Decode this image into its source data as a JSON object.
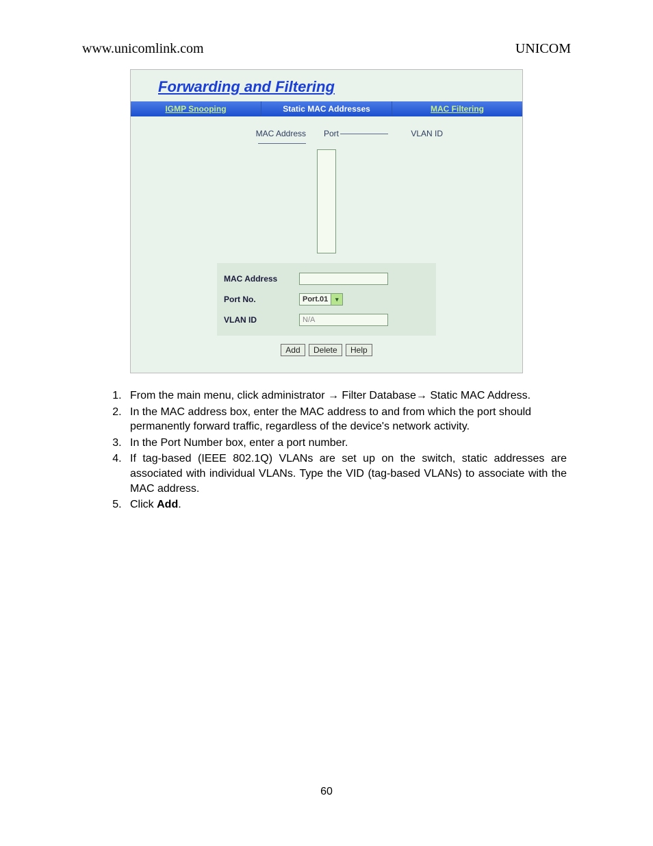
{
  "header": {
    "left": "www.unicomlink.com",
    "right": "UNICOM"
  },
  "screenshot": {
    "title": "Forwarding and Filtering",
    "tabs": [
      {
        "label": "IGMP Snooping",
        "active": false
      },
      {
        "label": "Static MAC Addresses",
        "active": true
      },
      {
        "label": "MAC Filtering",
        "active": false
      }
    ],
    "columns": {
      "c1": "MAC Address",
      "c2": "Port",
      "c3": "VLAN ID"
    },
    "form": {
      "mac_label": "MAC Address",
      "mac_value": "",
      "port_label": "Port No.",
      "port_value": "Port.01",
      "vlan_label": "VLAN ID",
      "vlan_value": "N/A"
    },
    "buttons": {
      "add": "Add",
      "delete": "Delete",
      "help": "Help"
    }
  },
  "instructions": {
    "i1a": "From the main menu, click administrator ",
    "i1b": " Filter Database",
    "i1c": " Static MAC Address.",
    "i2": "In the MAC address box, enter the MAC address to and from which the port should permanently forward traffic, regardless of the device's network activity.",
    "i3": "In the Port Number box, enter a port number.",
    "i4": "If tag-based (IEEE 802.1Q) VLANs are set up on the switch, static addresses are associated with individual VLANs. Type the VID (tag-based VLANs) to associate with the MAC address.",
    "i5a": "Click ",
    "i5b": "Add",
    "i5c": "."
  },
  "arrow": "→",
  "page_number": "60"
}
